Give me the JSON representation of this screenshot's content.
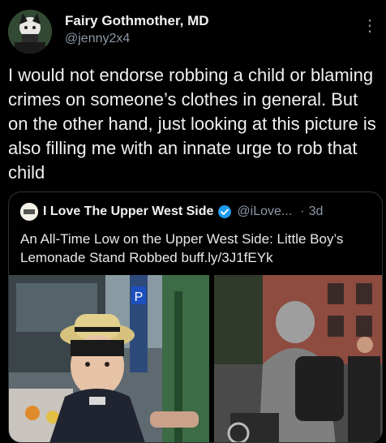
{
  "author": {
    "display_name": "Fairy Gothmother, MD",
    "handle": "@jenny2x4"
  },
  "tweet": {
    "text": "I would not endorse robbing a child or blaming crimes on someone’s clothes in general. But on the other hand, just looking at this picture is also filling me with an innate urge to rob that child"
  },
  "quoted": {
    "display_name": "I Love The Upper West Side",
    "handle": "@iLove...",
    "separator": "·",
    "time": "3d",
    "text": "An All-Time Low on the Upper West Side: Little Boy’s Lemonade Stand Robbed buff.ly/3J1fEYk",
    "avatar_text": "I love the UWS",
    "verified_color": "#1d9bf0"
  },
  "media": {
    "left_sign_letter": "P"
  },
  "icons": {
    "more": "more-options-icon",
    "verified": "verified-badge-icon"
  }
}
